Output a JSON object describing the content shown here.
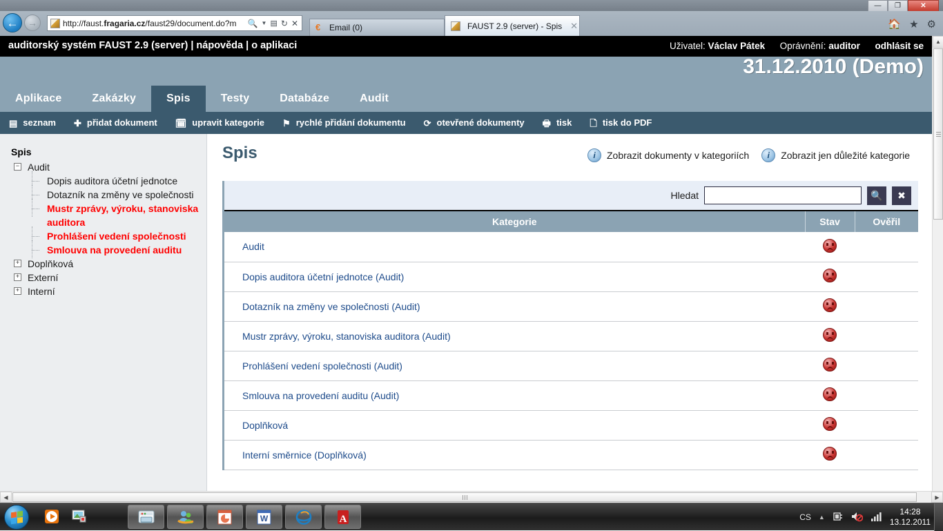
{
  "window": {
    "title_bar_text": "",
    "minimize_label": "—",
    "maximize_label": "❐",
    "close_label": "✕"
  },
  "browser": {
    "back_label": "←",
    "forward_label": "→",
    "url_prefix": "http://faust.",
    "url_host": "fragaria.cz",
    "url_suffix": "/faust29/document.do?m",
    "address_icons": [
      "search-icon",
      "dropdown-caret",
      "compat-view-icon",
      "refresh-icon",
      "stop-icon"
    ],
    "tabs": [
      {
        "label": "Email (0)",
        "active": false,
        "icon": "email-icon",
        "closable": false
      },
      {
        "label": "FAUST 2.9 (server) - Spis",
        "active": true,
        "icon": "faust-favicon",
        "closable": true,
        "close_label": "✕"
      }
    ],
    "toolbar_icons": [
      "home-icon",
      "favorites-star-icon",
      "tools-gear-icon"
    ]
  },
  "app": {
    "header_left": "auditorský systém FAUST 2.9 (server) | nápověda | o aplikaci",
    "user_label": "Uživatel:",
    "user_name": "Václav Pátek",
    "role_label": "Oprávnění:",
    "role_value": "auditor",
    "logout_label": "odhlásit se",
    "date_banner": "31.12.2010 (Demo)",
    "tabs": [
      {
        "label": "Aplikace",
        "active": false
      },
      {
        "label": "Zakázky",
        "active": false
      },
      {
        "label": "Spis",
        "active": true
      },
      {
        "label": "Testy",
        "active": false
      },
      {
        "label": "Databáze",
        "active": false
      },
      {
        "label": "Audit",
        "active": false
      }
    ],
    "subbar": [
      {
        "label": "seznam",
        "icon": "list-icon"
      },
      {
        "label": "přidat dokument",
        "icon": "plus-icon"
      },
      {
        "label": "upravit kategorie",
        "icon": "calendar-icon"
      },
      {
        "label": "rychlé přidání dokumentu",
        "icon": "flag-icon"
      },
      {
        "label": "otevřené dokumenty",
        "icon": "refresh-icon"
      },
      {
        "label": "tisk",
        "icon": "printer-icon"
      },
      {
        "label": "tisk do PDF",
        "icon": "document-icon"
      }
    ]
  },
  "sidebar": {
    "root_label": "Spis",
    "nodes": [
      {
        "label": "Audit",
        "level": 1,
        "toggle": "−",
        "red": false
      },
      {
        "label": "Dopis auditora účetní jednotce",
        "level": 2,
        "red": false
      },
      {
        "label": "Dotazník na změny ve společnosti",
        "level": 2,
        "red": false
      },
      {
        "label": "Mustr zprávy, výroku, stanoviska auditora",
        "level": 2,
        "red": true
      },
      {
        "label": "Prohlášení vedení společnosti",
        "level": 2,
        "red": true
      },
      {
        "label": "Smlouva na provedení auditu",
        "level": 2,
        "red": true
      },
      {
        "label": "Doplňková",
        "level": 1,
        "toggle": "+",
        "red": false
      },
      {
        "label": "Externí",
        "level": 1,
        "toggle": "+",
        "red": false
      },
      {
        "label": "Interní",
        "level": 1,
        "toggle": "+",
        "red": false
      }
    ]
  },
  "main": {
    "page_title": "Spis",
    "head_links": [
      {
        "label": "Zobrazit dokumenty v kategoriích",
        "icon": "info-icon"
      },
      {
        "label": "Zobrazit jen důležité kategorie",
        "icon": "info-icon"
      }
    ],
    "search": {
      "label": "Hledat",
      "value": "",
      "placeholder": "",
      "search_button_icon": "search-icon",
      "clear_button_icon": "close-icon"
    },
    "table": {
      "columns": [
        "Kategorie",
        "Stav",
        "Ověřil"
      ],
      "rows": [
        {
          "kategorie": "Audit",
          "stav": "sad-face-icon",
          "overil": ""
        },
        {
          "kategorie": "Dopis auditora účetní jednotce (Audit)",
          "stav": "sad-face-icon",
          "overil": ""
        },
        {
          "kategorie": "Dotazník na změny ve společnosti (Audit)",
          "stav": "sad-face-icon",
          "overil": ""
        },
        {
          "kategorie": "Mustr zprávy, výroku, stanoviska auditora (Audit)",
          "stav": "sad-face-icon",
          "overil": ""
        },
        {
          "kategorie": "Prohlášení vedení společnosti (Audit)",
          "stav": "sad-face-icon",
          "overil": ""
        },
        {
          "kategorie": "Smlouva na provedení auditu (Audit)",
          "stav": "sad-face-icon",
          "overil": ""
        },
        {
          "kategorie": "Doplňková",
          "stav": "sad-face-icon",
          "overil": ""
        },
        {
          "kategorie": "Interní směrnice (Doplňková)",
          "stav": "sad-face-icon",
          "overil": ""
        }
      ]
    }
  },
  "taskbar": {
    "start_label": "Start",
    "quick_launch": [
      "media-player-icon",
      "photo-gallery-icon"
    ],
    "buttons": [
      "folder-icon",
      "messenger-icon",
      "powerpoint-icon",
      "word-icon",
      "internet-explorer-icon",
      "acrobat-reader-icon"
    ],
    "tray": {
      "language": "CS",
      "show_hidden": "▲",
      "icons": [
        "network-plug-icon",
        "volume-muted-icon",
        "signal-bars-icon"
      ],
      "time": "14:28",
      "date": "13.12.2011"
    }
  },
  "colors": {
    "accent_dark": "#3b5a6e",
    "accent_light": "#8ba3b3",
    "link": "#1c4a8a",
    "alert_red": "#ff0000",
    "search_panel": "#e8eef7"
  }
}
